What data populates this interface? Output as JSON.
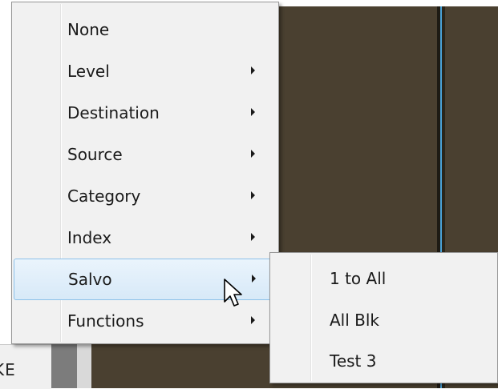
{
  "background": {
    "partial_label": "KE",
    "colors": {
      "panel": "#4a4030",
      "divider_accent": "#4aa3d8"
    }
  },
  "context_menu": {
    "items": [
      {
        "label": "None",
        "has_submenu": false,
        "highlighted": false
      },
      {
        "label": "Level",
        "has_submenu": true,
        "highlighted": false
      },
      {
        "label": "Destination",
        "has_submenu": true,
        "highlighted": false
      },
      {
        "label": "Source",
        "has_submenu": true,
        "highlighted": false
      },
      {
        "label": "Category",
        "has_submenu": true,
        "highlighted": false
      },
      {
        "label": "Index",
        "has_submenu": true,
        "highlighted": false
      },
      {
        "label": "Salvo",
        "has_submenu": true,
        "highlighted": true
      },
      {
        "label": "Functions",
        "has_submenu": true,
        "highlighted": false
      }
    ],
    "submenu_arrow_icon": "chevron-right-icon",
    "highlight_color": "#d7e9f8"
  },
  "salvo_submenu": {
    "items": [
      {
        "label": "1 to All"
      },
      {
        "label": "All Blk"
      },
      {
        "label": "Test 3"
      }
    ]
  },
  "cursor": {
    "icon": "mouse-pointer-icon"
  }
}
